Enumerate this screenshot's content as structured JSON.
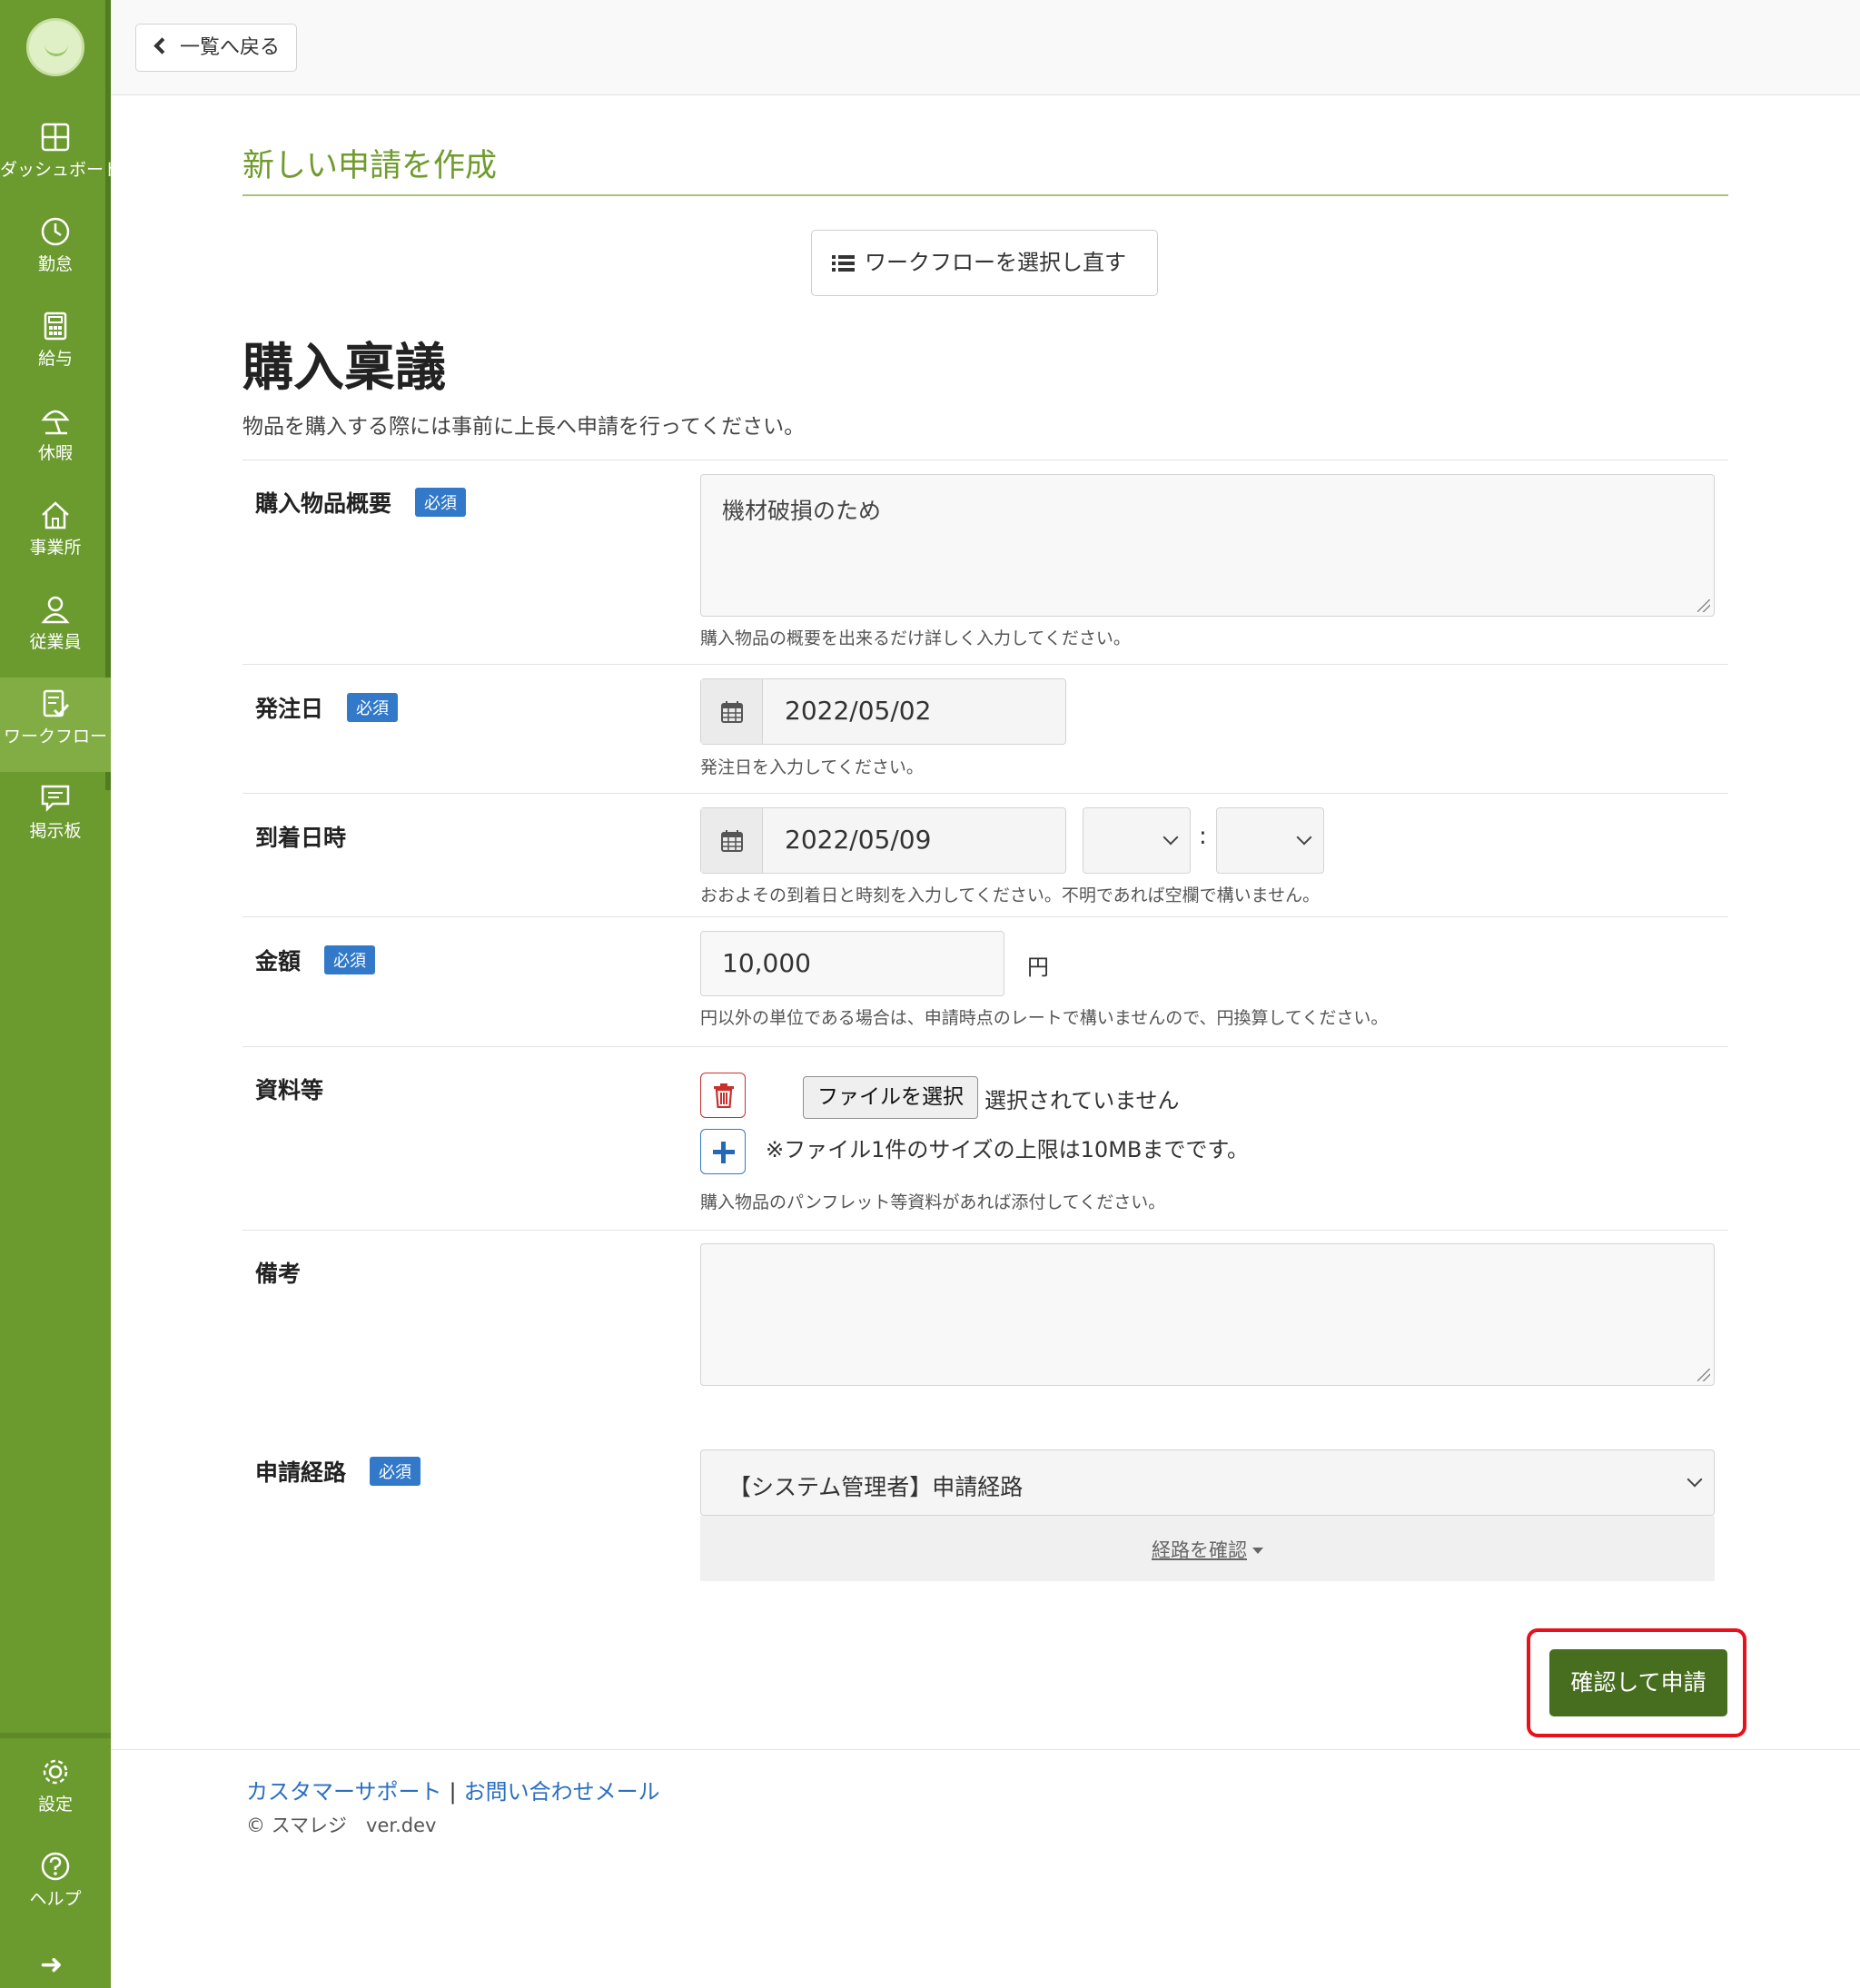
{
  "colors": {
    "sidebar": "#6b9a2f",
    "accent_title": "#6f9c2d",
    "submit": "#466e1e",
    "required_badge": "#3279c9",
    "link": "#2b6fc0",
    "highlight": "#e8111b"
  },
  "sidebar": {
    "items": [
      {
        "label": "ダッシュボード",
        "icon": "dashboard-icon"
      },
      {
        "label": "勤怠",
        "icon": "clock-icon"
      },
      {
        "label": "給与",
        "icon": "calculator-icon"
      },
      {
        "label": "休暇",
        "icon": "beach-umbrella-icon"
      },
      {
        "label": "事業所",
        "icon": "home-icon"
      },
      {
        "label": "従業員",
        "icon": "user-icon"
      },
      {
        "label": "ワークフロー",
        "icon": "workflow-icon",
        "active": true
      },
      {
        "label": "掲示板",
        "icon": "message-icon"
      }
    ],
    "bottom_items": [
      {
        "label": "設定",
        "icon": "gear-icon"
      },
      {
        "label": "ヘルプ",
        "icon": "help-icon"
      }
    ],
    "expand_icon": "arrow-right-icon"
  },
  "topbar": {
    "back_label": "一覧へ戻る"
  },
  "page": {
    "title": "新しい申請を作成",
    "reselect_workflow_label": "ワークフローを選択し直す"
  },
  "form": {
    "title": "購入稟議",
    "description": "物品を購入する際には事前に上長へ申請を行ってください。",
    "required_badge": "必須",
    "fields": {
      "summary": {
        "label": "購入物品概要",
        "value": "機材破損のため",
        "help": "購入物品の概要を出来るだけ詳しく入力してください。"
      },
      "order_date": {
        "label": "発注日",
        "value": "2022/05/02",
        "help": "発注日を入力してください。"
      },
      "arrival": {
        "label": "到着日時",
        "date": "2022/05/09",
        "hour": "",
        "minute": "",
        "separator": ":",
        "help": "おおよその到着日と時刻を入力してください。不明であれば空欄で構いません。"
      },
      "amount": {
        "label": "金額",
        "value": "10,000",
        "unit": "円",
        "help": "円以外の単位である場合は、申請時点のレートで構いませんので、円換算してください。"
      },
      "attachments": {
        "label": "資料等",
        "file_button": "ファイルを選択",
        "file_status": "選択されていません",
        "note": "※ファイル1件のサイズの上限は10MBまでです。",
        "help": "購入物品のパンフレット等資料があれば添付してください。"
      },
      "remarks": {
        "label": "備考",
        "value": ""
      },
      "route": {
        "label": "申請経路",
        "value": "【システム管理者】申請経路",
        "check_link": "経路を確認"
      }
    },
    "submit_label": "確認して申請"
  },
  "footer": {
    "support_link": "カスタマーサポート",
    "separator": "|",
    "mail_link": "お問い合わせメール",
    "copyright": "© スマレジ　ver.dev"
  }
}
